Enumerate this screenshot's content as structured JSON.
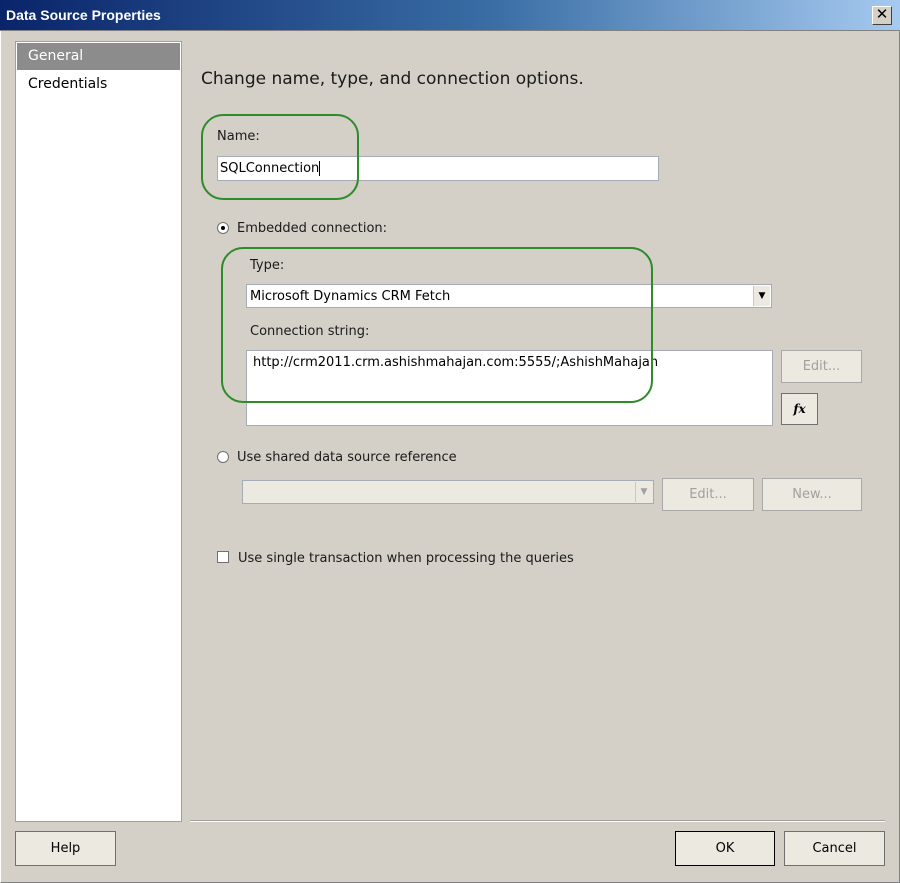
{
  "window": {
    "title": "Data Source Properties",
    "close_glyph": "✕"
  },
  "nav": {
    "items": [
      {
        "label": "General",
        "selected": true
      },
      {
        "label": "Credentials",
        "selected": false
      }
    ]
  },
  "main": {
    "heading": "Change name, type, and connection options.",
    "name_label": "Name:",
    "name_value": "SQLConnection",
    "embedded_label": "Embedded connection:",
    "embedded_selected": true,
    "type_label": "Type:",
    "type_value": "Microsoft Dynamics CRM Fetch",
    "conn_label": "Connection string:",
    "conn_value": "http://crm2011.crm.ashishmahajan.com:5555/;AshishMahajan",
    "edit_label": "Edit...",
    "fx_label": "fx",
    "shared_label": "Use shared data source reference",
    "shared_selected": false,
    "shared_value": "",
    "shared_edit_label": "Edit...",
    "shared_new_label": "New...",
    "single_tx_label": "Use single transaction when processing the queries",
    "single_tx_checked": false
  },
  "footer": {
    "help_label": "Help",
    "ok_label": "OK",
    "cancel_label": "Cancel"
  },
  "colors": {
    "title_gradient_start": "#0a246a",
    "highlight": "#2f8a2a",
    "nav_selected": "#8c8c8c"
  }
}
